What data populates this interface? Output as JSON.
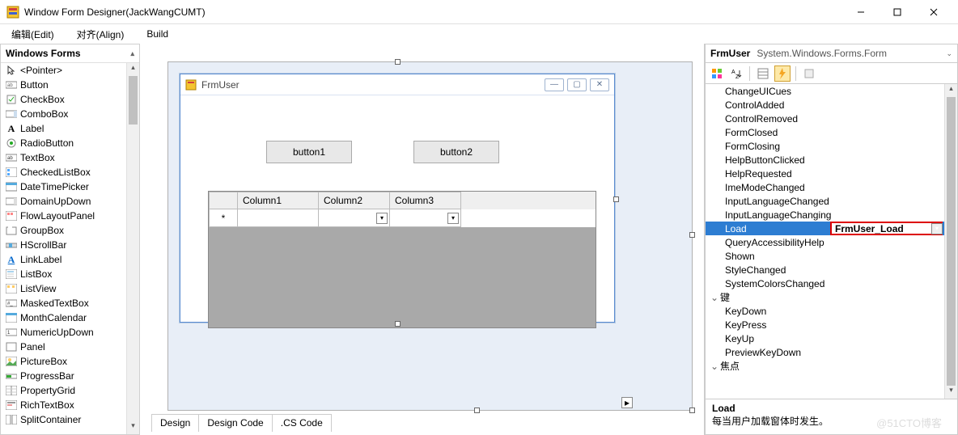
{
  "window": {
    "title": "Window Form Designer(JackWangCUMT)"
  },
  "menu": {
    "edit": "编辑(Edit)",
    "align": "对齐(Align)",
    "build": "Build"
  },
  "toolbox": {
    "title": "Windows Forms",
    "items": [
      "<Pointer>",
      "Button",
      "CheckBox",
      "ComboBox",
      "Label",
      "RadioButton",
      "TextBox",
      "CheckedListBox",
      "DateTimePicker",
      "DomainUpDown",
      "FlowLayoutPanel",
      "GroupBox",
      "HScrollBar",
      "LinkLabel",
      "ListBox",
      "ListView",
      "MaskedTextBox",
      "MonthCalendar",
      "NumericUpDown",
      "Panel",
      "PictureBox",
      "ProgressBar",
      "PropertyGrid",
      "RichTextBox",
      "SplitContainer"
    ]
  },
  "designer": {
    "form_title": "FrmUser",
    "button1": "button1",
    "button2": "button2",
    "columns": [
      "Column1",
      "Column2",
      "Column3"
    ],
    "row_marker": "*"
  },
  "bottom_tabs": {
    "design": "Design",
    "design_code": "Design Code",
    "cs_code": ".CS Code"
  },
  "props": {
    "selected_object": "FrmUser",
    "selected_type": "System.Windows.Forms.Form",
    "events": [
      "ChangeUICues",
      "ControlAdded",
      "ControlRemoved",
      "FormClosed",
      "FormClosing",
      "HelpButtonClicked",
      "HelpRequested",
      "ImeModeChanged",
      "InputLanguageChanged",
      "InputLanguageChanging"
    ],
    "selected_event": "Load",
    "selected_value": "FrmUser_Load",
    "events_after": [
      "QueryAccessibilityHelp",
      "Shown",
      "StyleChanged",
      "SystemColorsChanged"
    ],
    "group_key": "键",
    "key_events": [
      "KeyDown",
      "KeyPress",
      "KeyUp",
      "PreviewKeyDown"
    ],
    "group_focus": "焦点",
    "desc_title": "Load",
    "desc_text": "每当用户加载窗体时发生。"
  },
  "watermark": "@51CTO博客"
}
